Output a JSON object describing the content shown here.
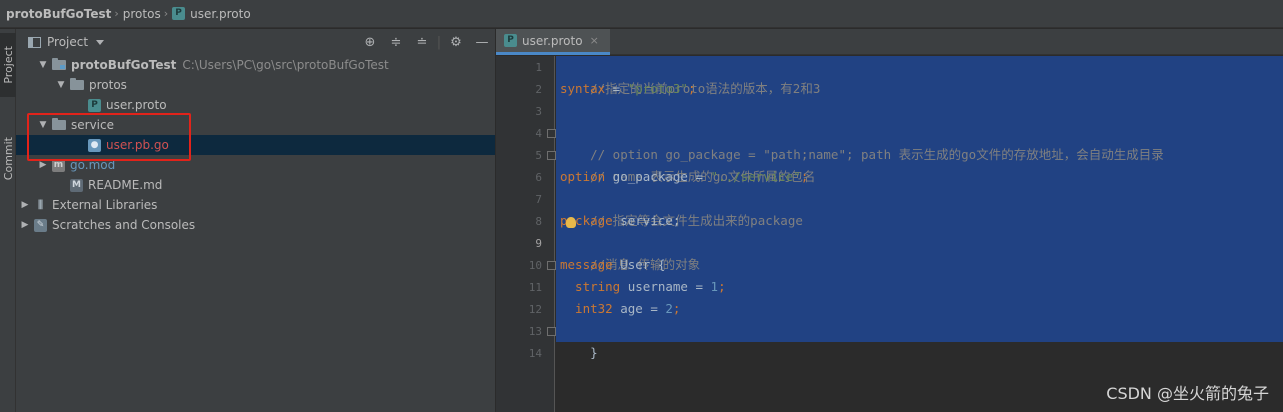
{
  "breadcrumb": {
    "project": "protoBufGoTest",
    "folder": "protos",
    "file_badge": "P",
    "file": "user.proto"
  },
  "toolstrip": {
    "project_tab": "Project",
    "commit_tab": "Commit"
  },
  "project_panel": {
    "title": "Project",
    "tools": [
      "target-icon",
      "expand-all-icon",
      "collapse-all-icon",
      "gear-icon",
      "minimize-icon"
    ],
    "tree": {
      "root": {
        "label": "protoBufGoTest",
        "path": "C:\\Users\\PC\\go\\src\\protoBufGoTest"
      },
      "protos": {
        "label": "protos"
      },
      "user_proto": {
        "label": "user.proto",
        "badge": "P"
      },
      "service": {
        "label": "service"
      },
      "user_pb_go": {
        "label": "user.pb.go"
      },
      "go_mod": {
        "label": "go.mod"
      },
      "readme": {
        "label": "README.md"
      },
      "external_libraries": {
        "label": "External Libraries"
      },
      "scratches": {
        "label": "Scratches and Consoles"
      }
    }
  },
  "editor": {
    "tab": {
      "badge": "P",
      "label": "user.proto",
      "close": "×"
    },
    "line_numbers": [
      "1",
      "2",
      "3",
      "4",
      "5",
      "6",
      "7",
      "8",
      "9",
      "10",
      "11",
      "12",
      "13",
      "14"
    ],
    "current_line": "9",
    "lines": {
      "l1": "//指定的当前proto语法的版本，有2和3",
      "l2_kw": "syntax",
      "l2_eq": " = ",
      "l2_str": "\"proto3\"",
      "l2_end": ";",
      "l4": "// option go_package = \"path;name\"; path 表示生成的go文件的存放地址，会自动生成目录",
      "l5": "// name 表示生成的go文件所属的包名",
      "l6_kw": "option",
      "l6_text": " go_package = ",
      "l6_str": "\"../service\"",
      "l6_end": ";",
      "l7": "// 指定等会文件生成出来的package",
      "l8_kw": "package",
      "l8_text": " service;",
      "l9": "//消息 传输的对象",
      "l10_kw": "message",
      "l10_text": " User {",
      "l11_kw": "  string",
      "l11_text": " username = ",
      "l11_num": "1",
      "l11_end": ";",
      "l12_kw": "  int32",
      "l12_text": " age = ",
      "l12_num": "2",
      "l12_end": ";",
      "l13": "}"
    }
  },
  "watermark": "CSDN @坐火箭的兔子",
  "colors": {
    "selection": "#214283",
    "keyword": "#cc7832",
    "string": "#6a8759",
    "number": "#6897bb",
    "comment": "#808080",
    "error_label": "#d25252",
    "highlight_box": "#e2231a"
  }
}
